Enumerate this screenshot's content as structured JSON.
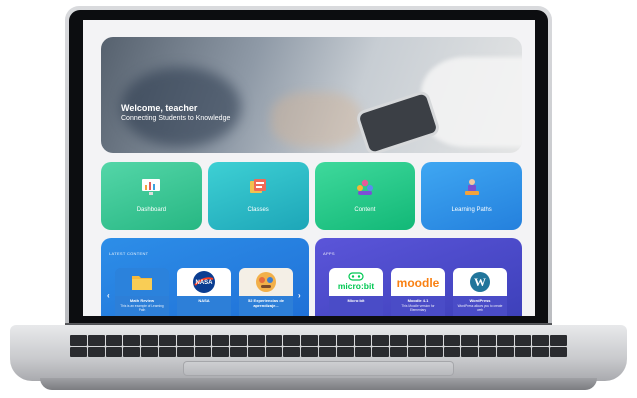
{
  "hero": {
    "title": "Welcome, teacher",
    "subtitle": "Connecting Students to Knowledge"
  },
  "tiles": [
    {
      "label": "Dashboard",
      "icon": "dashboard-icon"
    },
    {
      "label": "Classes",
      "icon": "classes-icon"
    },
    {
      "label": "Content",
      "icon": "content-icon"
    },
    {
      "label": "Learning Paths",
      "icon": "learning-paths-icon"
    }
  ],
  "latest_content": {
    "heading": "LATEST CONTENT",
    "items": [
      {
        "title": "Math Review",
        "desc": "This is an example of Learning Path",
        "thumb": "folder-icon"
      },
      {
        "title": "NASA",
        "desc": "",
        "thumb": "nasa-logo"
      },
      {
        "title": "52 Experiencias de aprendizaje...",
        "desc": "",
        "thumb": "illustration"
      }
    ]
  },
  "apps": {
    "heading": "APPS",
    "items": [
      {
        "title": "Micro:bit",
        "desc": "",
        "thumb": "microbit-logo",
        "logo_text": "micro:bit"
      },
      {
        "title": "Moodle 4.1",
        "desc": "This Moodle version for Elementary",
        "thumb": "moodle-logo",
        "logo_text": "moodle"
      },
      {
        "title": "WordPress",
        "desc": "WordPress allows you to create web",
        "thumb": "wordpress-logo",
        "logo_text": "W"
      }
    ]
  },
  "colors": {
    "dashboard": "#27b783",
    "classes": "#1da6b8",
    "content": "#12b877",
    "learning_paths": "#2480dd",
    "latest_panel": "#1f6fd6",
    "apps_panel": "#3b3fb8"
  }
}
